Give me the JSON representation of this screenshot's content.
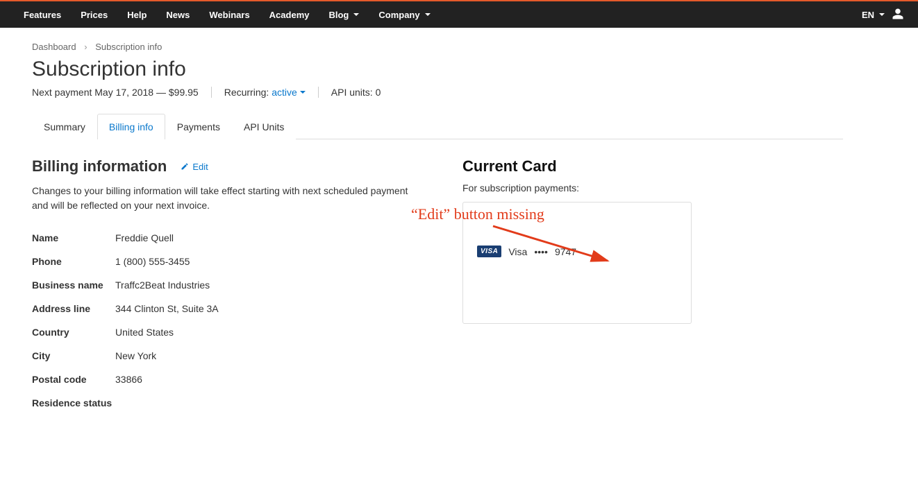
{
  "topnav": {
    "features": "Features",
    "prices": "Prices",
    "help": "Help",
    "news": "News",
    "webinars": "Webinars",
    "academy": "Academy",
    "blog": "Blog",
    "company": "Company"
  },
  "topright": {
    "lang": "EN"
  },
  "breadcrumb": {
    "dashboard": "Dashboard",
    "current": "Subscription info"
  },
  "page_title": "Subscription info",
  "subline": {
    "next_payment": "Next payment May 17, 2018 — $99.95",
    "recurring_label": "Recurring:",
    "recurring_state": "active",
    "api_units": "API units: 0"
  },
  "tabs": {
    "summary": "Summary",
    "billing_info": "Billing info",
    "payments": "Payments",
    "api_units": "API Units"
  },
  "billing": {
    "heading": "Billing information",
    "edit": "Edit",
    "desc": "Changes to your billing information will take effect starting with next scheduled payment and will be reflected on your next invoice.",
    "labels": {
      "name": "Name",
      "phone": "Phone",
      "business_name": "Business name",
      "address_line": "Address line",
      "country": "Country",
      "city": "City",
      "postal_code": "Postal code",
      "residence_status": "Residence status"
    },
    "values": {
      "name": "Freddie Quell",
      "phone": "1 (800) 555-3455",
      "business_name": "Traffc2Beat Industries",
      "address_line": "344 Clinton St, Suite 3A",
      "country": "United States",
      "city": "New York",
      "postal_code": "33866",
      "residence_status": ""
    }
  },
  "card": {
    "heading": "Current Card",
    "sub": "For subscription payments:",
    "brand_badge": "VISA",
    "brand": "Visa",
    "mask": "••••",
    "last4": "9747"
  },
  "annotation": {
    "text": "“Edit” button missing"
  }
}
